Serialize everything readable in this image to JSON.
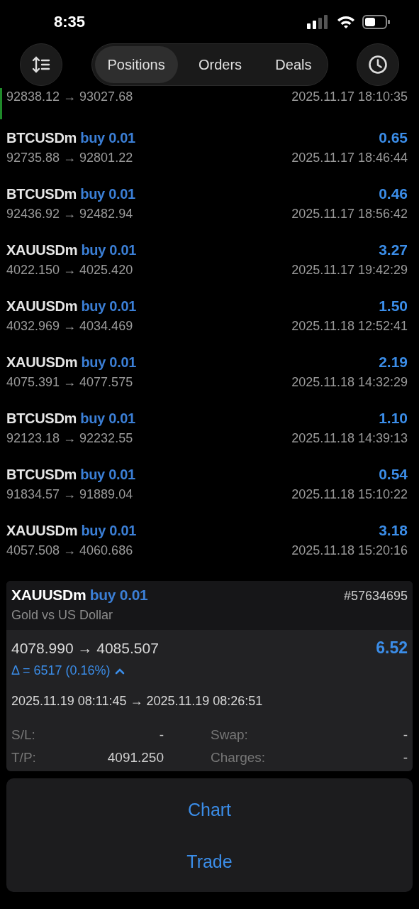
{
  "status_bar": {
    "time": "8:35"
  },
  "toolbar": {
    "tabs": [
      {
        "label": "Positions",
        "selected": true
      },
      {
        "label": "Orders",
        "selected": false
      },
      {
        "label": "Deals",
        "selected": false
      }
    ]
  },
  "partial_row": {
    "prices": "92838.12 → 93027.68",
    "time": "2025.11.17 18:10:35"
  },
  "deals": [
    {
      "symbol": "BTCUSDm",
      "action": "buy 0.01",
      "profit": "0.65",
      "prices": "92735.88 → 92801.22",
      "time": "2025.11.17 18:46:44"
    },
    {
      "symbol": "BTCUSDm",
      "action": "buy 0.01",
      "profit": "0.46",
      "prices": "92436.92 → 92482.94",
      "time": "2025.11.17 18:56:42"
    },
    {
      "symbol": "XAUUSDm",
      "action": "buy 0.01",
      "profit": "3.27",
      "prices": "4022.150 → 4025.420",
      "time": "2025.11.17 19:42:29"
    },
    {
      "symbol": "XAUUSDm",
      "action": "buy 0.01",
      "profit": "1.50",
      "prices": "4032.969 → 4034.469",
      "time": "2025.11.18 12:52:41"
    },
    {
      "symbol": "XAUUSDm",
      "action": "buy 0.01",
      "profit": "2.19",
      "prices": "4075.391 → 4077.575",
      "time": "2025.11.18 14:32:29"
    },
    {
      "symbol": "BTCUSDm",
      "action": "buy 0.01",
      "profit": "1.10",
      "prices": "92123.18 → 92232.55",
      "time": "2025.11.18 14:39:13"
    },
    {
      "symbol": "BTCUSDm",
      "action": "buy 0.01",
      "profit": "0.54",
      "prices": "91834.57 → 91889.04",
      "time": "2025.11.18 15:10:22"
    },
    {
      "symbol": "XAUUSDm",
      "action": "buy 0.01",
      "profit": "3.18",
      "prices": "4057.508 → 4060.686",
      "time": "2025.11.18 15:20:16"
    }
  ],
  "detail": {
    "symbol": "XAUUSDm",
    "action": "buy 0.01",
    "ticket": "#57634695",
    "description": "Gold vs US Dollar",
    "prices": "4078.990 → 4085.507",
    "profit": "6.52",
    "delta": "Δ = 6517 (0.16%)",
    "times": "2025.11.19 08:11:45 → 2025.11.19 08:26:51",
    "fields": [
      {
        "label": "S/L:",
        "value": "-"
      },
      {
        "label": "Swap:",
        "value": "-"
      },
      {
        "label": "T/P:",
        "value": "4091.250"
      },
      {
        "label": "Charges:",
        "value": "-"
      }
    ]
  },
  "action_sheet": [
    "Chart",
    "Trade"
  ]
}
